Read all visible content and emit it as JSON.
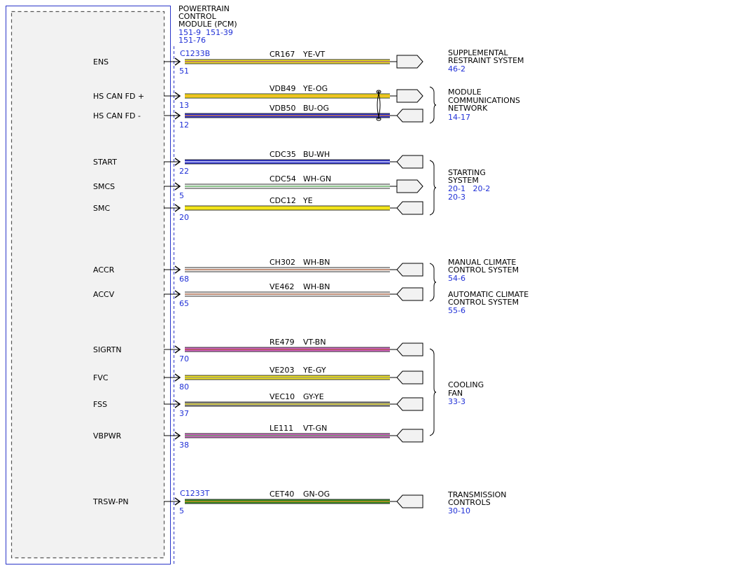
{
  "module": {
    "title_lines": [
      "POWERTRAIN",
      "CONTROL",
      "MODULE (PCM)"
    ],
    "ref_lines": [
      "151-9  151-39",
      "151-76"
    ]
  },
  "connector_top": "C1233B",
  "connector_bottom": "C1233T",
  "circuits": [
    {
      "pin_label": "ENS",
      "pin": "51",
      "circuit": "CR167",
      "color": "YE-VT",
      "wire_colors": [
        "#f3e51a",
        "#8a3fa0"
      ],
      "conn": "arrow-right"
    },
    {
      "pin_label": "HS CAN FD +",
      "pin": "13",
      "circuit": "VDB49",
      "color": "YE-OG",
      "wire_colors": [
        "#f3e51a",
        "#f0902a"
      ],
      "conn": "arrow-right"
    },
    {
      "pin_label": "HS CAN FD -",
      "pin": "12",
      "circuit": "VDB50",
      "color": "BU-OG",
      "wire_colors": [
        "#2a2fd0",
        "#f0902a"
      ],
      "conn": "arrow-left"
    },
    {
      "pin_label": "START",
      "pin": "22",
      "circuit": "CDC35",
      "color": "BU-WH",
      "wire_colors": [
        "#2a2fd0",
        "#ffffff"
      ],
      "conn": "arrow-left"
    },
    {
      "pin_label": "SMCS",
      "pin": "5",
      "circuit": "CDC54",
      "color": "WH-GN",
      "wire_colors": [
        "#f4f4f4",
        "#4aa84a"
      ],
      "conn": "arrow-right"
    },
    {
      "pin_label": "SMC",
      "pin": "20",
      "circuit": "CDC12",
      "color": "YE",
      "wire_colors": [
        "#f3e51a",
        "#f3e51a"
      ],
      "conn": "arrow-left"
    },
    {
      "pin_label": "ACCR",
      "pin": "68",
      "circuit": "CH302",
      "color": "WH-BN",
      "wire_colors": [
        "#f4f4f4",
        "#a0522d"
      ],
      "conn": "arrow-left"
    },
    {
      "pin_label": "ACCV",
      "pin": "65",
      "circuit": "VE462",
      "color": "WH-BN",
      "wire_colors": [
        "#f4f4f4",
        "#a0522d"
      ],
      "conn": "arrow-left"
    },
    {
      "pin_label": "SIGRTN",
      "pin": "70",
      "circuit": "RE479",
      "color": "VT-BN",
      "wire_colors": [
        "#d463c8",
        "#a0522d"
      ],
      "conn": "arrow-left"
    },
    {
      "pin_label": "FVC",
      "pin": "80",
      "circuit": "VE203",
      "color": "YE-GY",
      "wire_colors": [
        "#f3e51a",
        "#8a8a8a"
      ],
      "conn": "arrow-left"
    },
    {
      "pin_label": "FSS",
      "pin": "37",
      "circuit": "VEC10",
      "color": "GY-YE",
      "wire_colors": [
        "#8a8a8a",
        "#f3e51a"
      ],
      "conn": "arrow-left"
    },
    {
      "pin_label": "VBPWR",
      "pin": "38",
      "circuit": "LE111",
      "color": "VT-GN",
      "wire_colors": [
        "#d463c8",
        "#4aa84a"
      ],
      "conn": "arrow-left"
    },
    {
      "pin_label": "TRSW-PN",
      "pin": "5",
      "circuit": "CET40",
      "color": "GN-OG",
      "wire_colors": [
        "#2f8a1e",
        "#f0902a"
      ],
      "conn": "arrow-left"
    }
  ],
  "systems": [
    {
      "name_lines": [
        "SUPPLEMENTAL",
        "RESTRAINT SYSTEM"
      ],
      "ref_lines": [
        "46-2"
      ]
    },
    {
      "name_lines": [
        "MODULE",
        "COMMUNICATIONS",
        "NETWORK"
      ],
      "ref_lines": [
        "14-17"
      ]
    },
    {
      "name_lines": [
        "STARTING",
        "SYSTEM"
      ],
      "ref_lines": [
        "20-1   20-2",
        "20-3"
      ]
    },
    {
      "name_lines": [
        "MANUAL CLIMATE",
        "CONTROL SYSTEM"
      ],
      "ref_lines": [
        "54-6"
      ]
    },
    {
      "name_lines": [
        "AUTOMATIC CLIMATE",
        "CONTROL SYSTEM"
      ],
      "ref_lines": [
        "55-6"
      ]
    },
    {
      "name_lines": [
        "COOLING",
        "FAN"
      ],
      "ref_lines": [
        "33-3"
      ]
    },
    {
      "name_lines": [
        "TRANSMISSION",
        "CONTROLS"
      ],
      "ref_lines": [
        "30-10"
      ]
    }
  ],
  "colors": {
    "module_outline": "#2a35c8",
    "module_fill": "#f2f2f2",
    "reference_text": "#1f2fd6",
    "connector_fill": "#f2f2f2"
  }
}
